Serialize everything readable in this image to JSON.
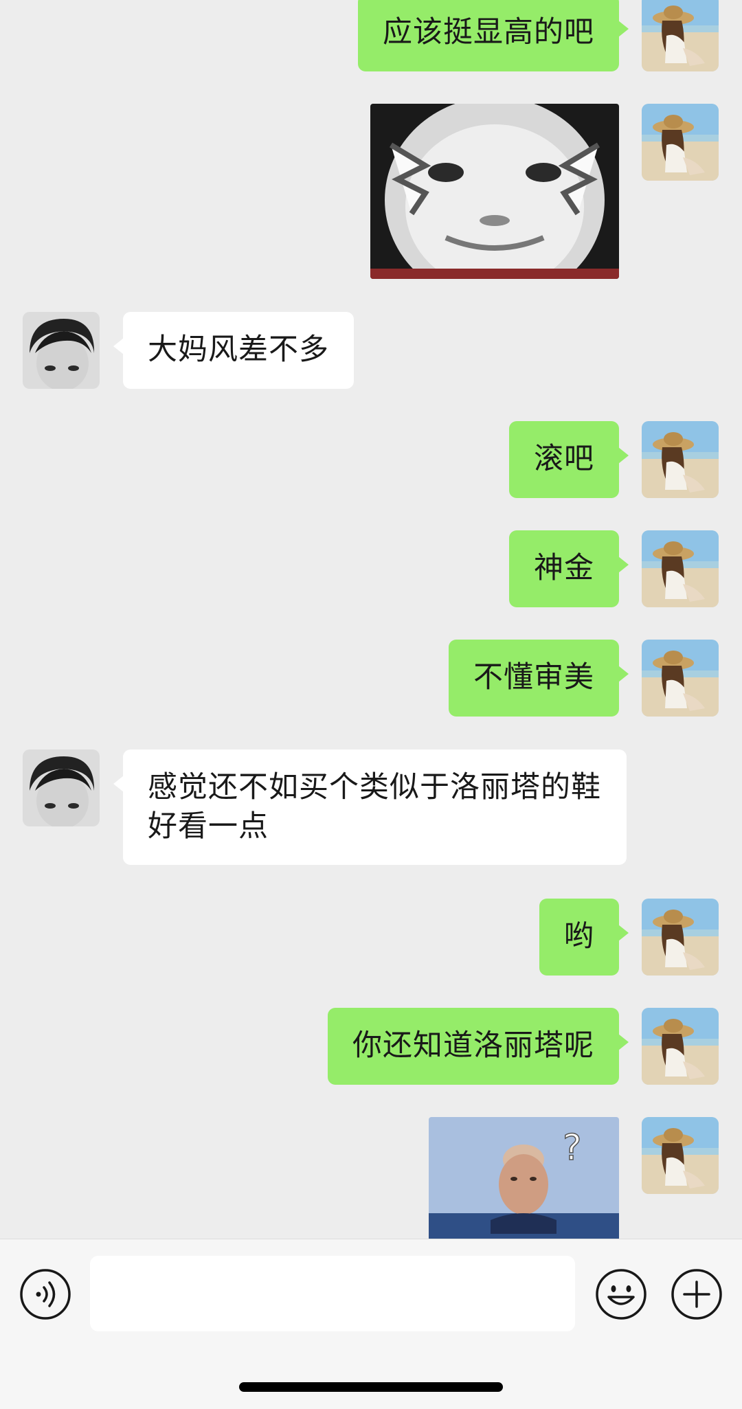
{
  "colors": {
    "background": "#ededed",
    "bubble_me": "#95ec69",
    "bubble_other": "#ffffff",
    "text": "#191919"
  },
  "messages": [
    {
      "sender": "me",
      "type": "text",
      "text": "应该挺显高的吧"
    },
    {
      "sender": "me",
      "type": "sticker",
      "description_icon": "cartoon-face-sticker"
    },
    {
      "sender": "other",
      "type": "text",
      "text": "大妈风差不多"
    },
    {
      "sender": "me",
      "type": "text",
      "text": "滚吧"
    },
    {
      "sender": "me",
      "type": "text",
      "text": "神金"
    },
    {
      "sender": "me",
      "type": "text",
      "text": "不懂审美"
    },
    {
      "sender": "other",
      "type": "text",
      "text": "感觉还不如买个类似于洛丽塔的鞋好看一点"
    },
    {
      "sender": "me",
      "type": "text",
      "text": "哟"
    },
    {
      "sender": "me",
      "type": "text",
      "text": "你还知道洛丽塔呢"
    },
    {
      "sender": "me",
      "type": "sticker",
      "description_icon": "man-in-water-question-sticker",
      "sticker_text": "?"
    }
  ],
  "input_bar": {
    "text_value": "",
    "voice_icon": "voice-icon",
    "emoji_icon": "emoji-icon",
    "plus_icon": "plus-icon"
  }
}
